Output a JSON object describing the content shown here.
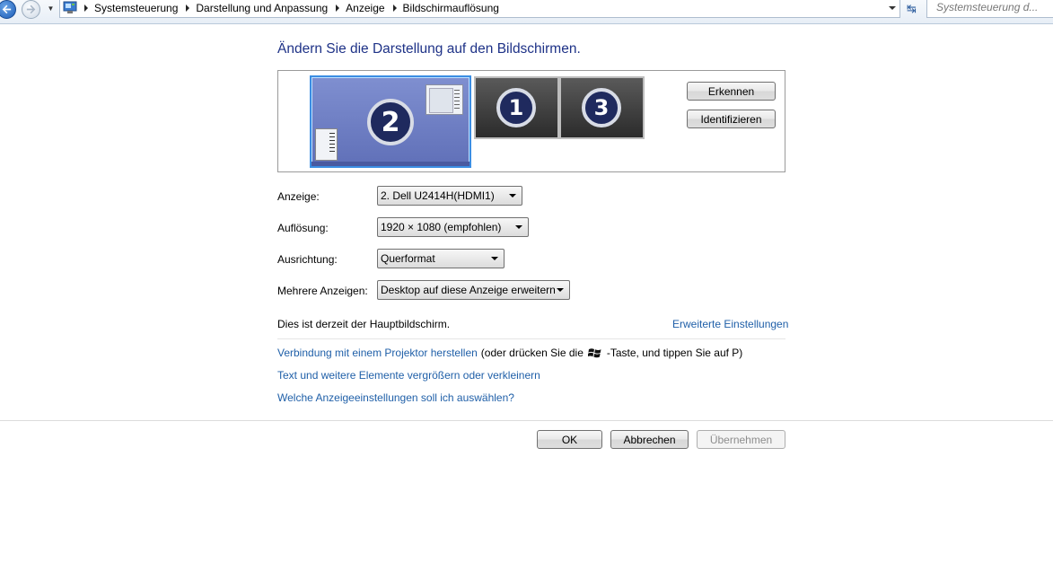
{
  "address_bar": {
    "breadcrumbs": [
      "Systemsteuerung",
      "Darstellung und Anpassung",
      "Anzeige",
      "Bildschirmauflösung"
    ],
    "search_placeholder": "Systemsteuerung d..."
  },
  "page": {
    "title": "Ändern Sie die Darstellung auf den Bildschirmen."
  },
  "monitors": {
    "items": [
      {
        "number": "2",
        "selected": true
      },
      {
        "number": "1",
        "selected": false
      },
      {
        "number": "3",
        "selected": false
      }
    ],
    "detect_label": "Erkennen",
    "identify_label": "Identifizieren"
  },
  "settings": {
    "display": {
      "label": "Anzeige:",
      "value": "2. Dell U2414H(HDMI1)"
    },
    "resolution": {
      "label": "Auflösung:",
      "value": "1920 × 1080 (empfohlen)"
    },
    "orientation": {
      "label": "Ausrichtung:",
      "value": "Querformat"
    },
    "multiple_displays": {
      "label": "Mehrere Anzeigen:",
      "value": "Desktop auf diese Anzeige erweitern"
    }
  },
  "info": {
    "main_display_text": "Dies ist derzeit der Hauptbildschirm.",
    "advanced_link": "Erweiterte Einstellungen"
  },
  "links": {
    "projector_link": "Verbindung mit einem Projektor herstellen",
    "projector_hint_before": "(oder drücken Sie die",
    "projector_hint_after": "-Taste, und tippen Sie auf P)",
    "text_size_link": "Text und weitere Elemente vergrößern oder verkleinern",
    "which_settings_link": "Welche Anzeigeeinstellungen soll ich auswählen?"
  },
  "buttons": {
    "ok": "OK",
    "cancel": "Abbrechen",
    "apply": "Übernehmen"
  }
}
